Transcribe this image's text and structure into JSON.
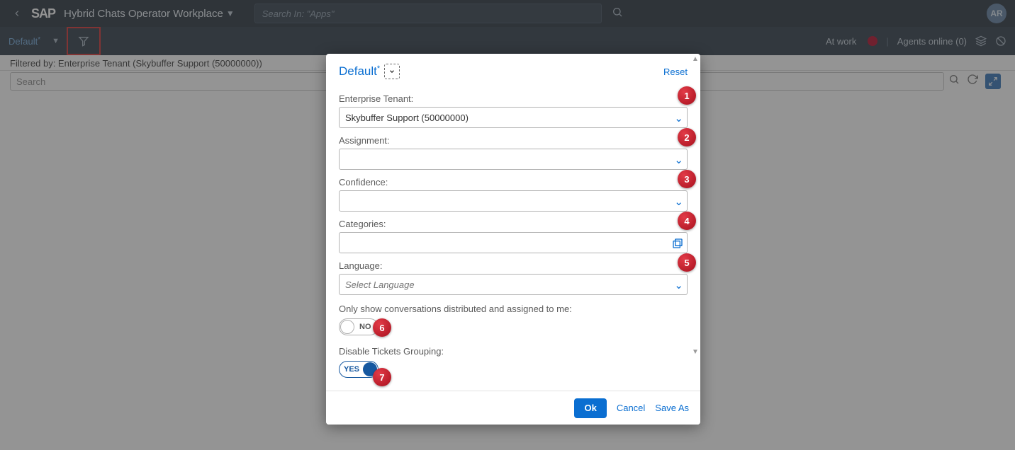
{
  "shell": {
    "app_title": "Hybrid Chats Operator Workplace",
    "search_placeholder": "Search In: \"Apps\"",
    "avatar_initials": "AR",
    "variant": "Default",
    "at_work_label": "At work",
    "agents_online_label": "Agents online (0)"
  },
  "filterbar": {
    "text": "Filtered by: Enterprise Tenant (Skybuffer Support (50000000))",
    "list_search_placeholder": "Search"
  },
  "dialog": {
    "title": "Default",
    "reset": "Reset",
    "fields": {
      "enterprise_tenant": {
        "label": "Enterprise Tenant:",
        "value": "Skybuffer Support (50000000)"
      },
      "assignment": {
        "label": "Assignment:",
        "value": ""
      },
      "confidence": {
        "label": "Confidence:",
        "value": ""
      },
      "categories": {
        "label": "Categories:",
        "value": ""
      },
      "language": {
        "label": "Language:",
        "placeholder": "Select Language"
      }
    },
    "toggles": {
      "only_mine": {
        "label": "Only show conversations distributed and assigned to me:",
        "value": "NO"
      },
      "disable_grouping": {
        "label": "Disable Tickets Grouping:",
        "value": "YES"
      }
    },
    "footer": {
      "ok": "Ok",
      "cancel": "Cancel",
      "save_as": "Save As"
    }
  },
  "markers": {
    "m1": "1",
    "m2": "2",
    "m3": "3",
    "m4": "4",
    "m5": "5",
    "m6": "6",
    "m7": "7"
  }
}
